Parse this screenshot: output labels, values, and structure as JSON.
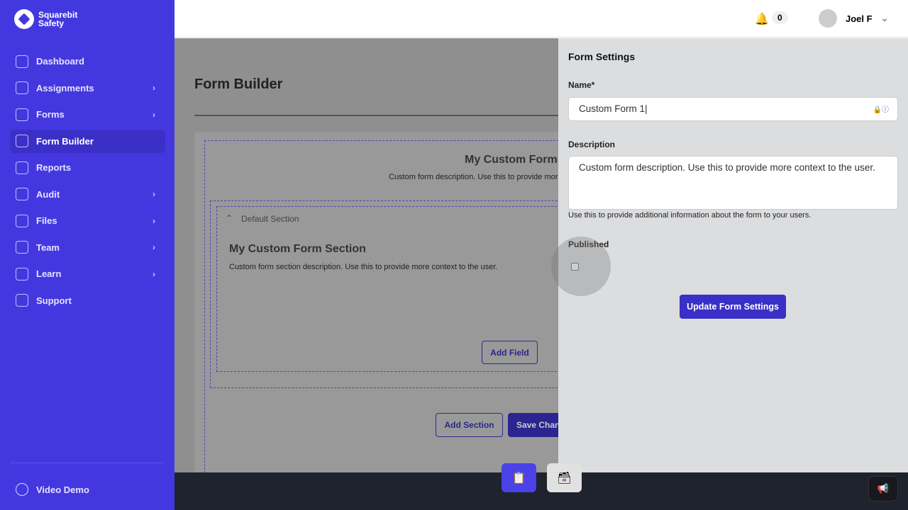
{
  "brand": {
    "line1": "Squarebit",
    "line2": "Safety"
  },
  "sidebar": {
    "items": [
      {
        "label": "Dashboard",
        "icon": "home-icon",
        "chevron": false
      },
      {
        "label": "Assignments",
        "icon": "calendar-icon",
        "chevron": true
      },
      {
        "label": "Forms",
        "icon": "documents-icon",
        "chevron": true
      },
      {
        "label": "Form Builder",
        "icon": "tools-icon",
        "chevron": false,
        "active": true
      },
      {
        "label": "Reports",
        "icon": "pie-chart-icon",
        "chevron": false
      },
      {
        "label": "Audit",
        "icon": "clipboard-icon",
        "chevron": true
      },
      {
        "label": "Files",
        "icon": "folder-icon",
        "chevron": true
      },
      {
        "label": "Team",
        "icon": "users-icon",
        "chevron": true
      },
      {
        "label": "Learn",
        "icon": "graduation-cap-icon",
        "chevron": true
      },
      {
        "label": "Support",
        "icon": "lifebuoy-icon",
        "chevron": false
      }
    ],
    "footer": "Video Demo",
    "chevron": "›"
  },
  "topbar": {
    "notifications": "0",
    "user": "Joel F",
    "bell": "🔔",
    "caret": "⌄"
  },
  "main": {
    "title": "Form Builder",
    "form_title": "My Custom Form",
    "form_desc": "Custom form description. Use this to provide more context to the user.",
    "section_label": "Default Section",
    "section_toggle": "⌃",
    "section_title": "My Custom Form Section",
    "section_desc": "Custom form section description. Use this to provide more context to the user.",
    "add_field": "Add Field",
    "add_section": "Add Section",
    "save_changes": "Save Changes"
  },
  "panel": {
    "title": "Form Settings",
    "name_label": "Name*",
    "name_value": "Custom Form 1",
    "description_label": "Description",
    "description_value": "Custom form description. Use this to provide more context to the user.",
    "description_help": "Use this to provide additional information about the form to your users.",
    "published_label": "Published",
    "published": false,
    "update_button": "Update Form Settings"
  },
  "colors": {
    "brand": "#4338e0",
    "primary_button": "#3a2fc6",
    "bottom_bar": "#1e232d"
  }
}
